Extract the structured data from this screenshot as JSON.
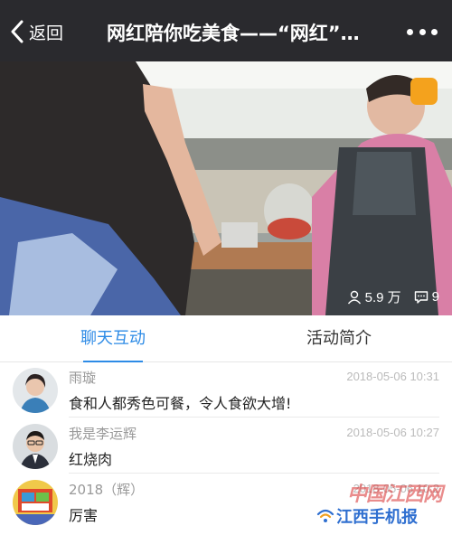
{
  "nav": {
    "back_label": "返回",
    "title": "网红陪你吃美食——“网红”遇上“正宗”"
  },
  "video": {
    "views": "5.9 万",
    "comments": "9"
  },
  "tabs": [
    {
      "label": "聊天互动"
    },
    {
      "label": "活动简介"
    }
  ],
  "comments": [
    {
      "name": "雨璇",
      "time": "2018-05-06 10:31",
      "text": "食和人都秀色可餐，令人食欲大增!"
    },
    {
      "name": "我是李运辉",
      "time": "2018-05-06 10:27",
      "text": "红烧肉"
    },
    {
      "name": "2018（辉）",
      "time": "2018-05-06 10:2",
      "text": "厉害"
    }
  ],
  "watermark": {
    "site": "中国江西网",
    "app": "江西手机报"
  },
  "colors": {
    "nav_bg": "#2a2a2e",
    "accent": "#2d8be6",
    "watermark_red": "#d83030",
    "watermark_blue": "#2f6fd0"
  }
}
